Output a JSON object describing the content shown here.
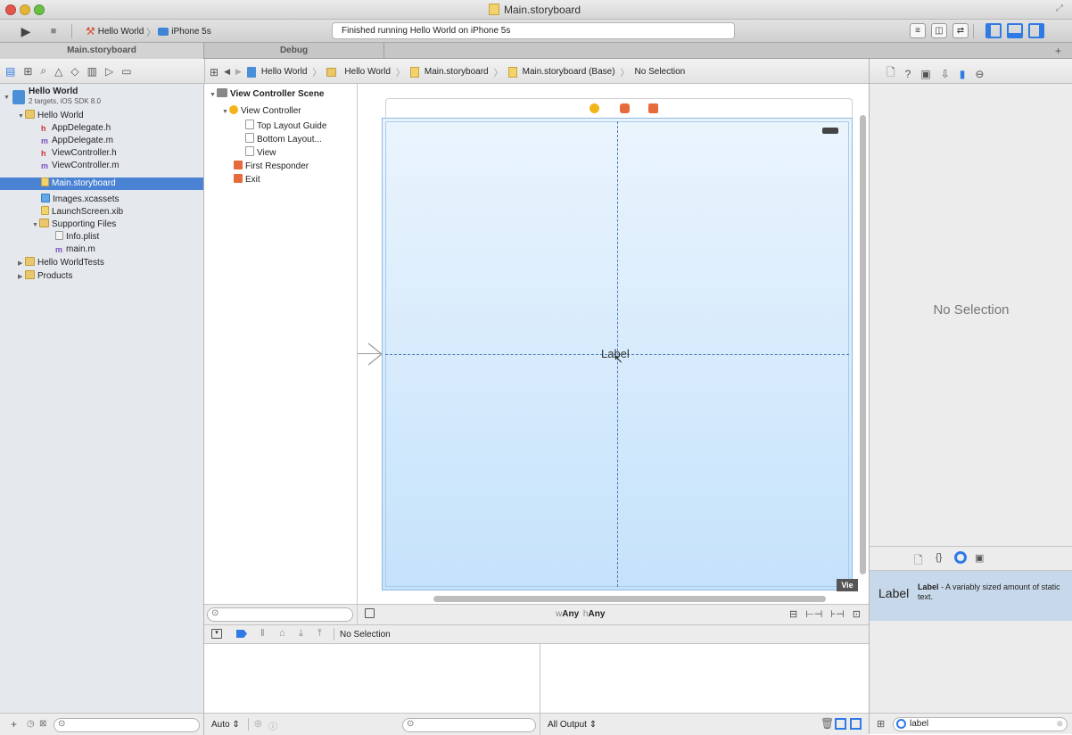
{
  "window": {
    "title": "Main.storyboard"
  },
  "toolbar": {
    "run_label": "▶",
    "stop_label": "■",
    "scheme": {
      "project": "Hello World",
      "separator": "〉",
      "device": "iPhone 5s"
    },
    "status_text": "Finished running Hello World on iPhone 5s"
  },
  "tabs": [
    {
      "label": "Main.storyboard"
    },
    {
      "label": "Debug"
    }
  ],
  "jumpbar": {
    "items": [
      "Hello World",
      "Hello World",
      "Main.storyboard",
      "Main.storyboard (Base)",
      "No Selection"
    ]
  },
  "navigator": {
    "project": {
      "name": "Hello World",
      "subtitle": "2 targets, iOS SDK 8.0"
    },
    "items": [
      {
        "label": "Hello World",
        "type": "folder"
      },
      {
        "label": "AppDelegate.h",
        "type": "h"
      },
      {
        "label": "AppDelegate.m",
        "type": "m"
      },
      {
        "label": "ViewController.h",
        "type": "h"
      },
      {
        "label": "ViewController.m",
        "type": "m"
      },
      {
        "label": "Main.storyboard",
        "type": "storyboard",
        "selected": true
      },
      {
        "label": "Images.xcassets",
        "type": "assets"
      },
      {
        "label": "LaunchScreen.xib",
        "type": "xib"
      },
      {
        "label": "Supporting Files",
        "type": "folder"
      },
      {
        "label": "Info.plist",
        "type": "plist"
      },
      {
        "label": "main.m",
        "type": "m"
      },
      {
        "label": "Hello WorldTests",
        "type": "folder"
      },
      {
        "label": "Products",
        "type": "folder"
      }
    ]
  },
  "outline": {
    "scene": "View Controller Scene",
    "view_controller": "View Controller",
    "top_guide": "Top Layout Guide",
    "bottom_guide": "Bottom Layout...",
    "view": "View",
    "first_responder": "First Responder",
    "exit": "Exit"
  },
  "canvas": {
    "label_text": "Label",
    "size_class": {
      "w_prefix": "w",
      "w_value": "Any",
      "h_prefix": "h",
      "h_value": "Any"
    },
    "corner_badge": "Vie"
  },
  "debug": {
    "status": "No Selection",
    "auto_label": "Auto",
    "output_label": "All Output"
  },
  "inspector": {
    "no_selection": "No Selection",
    "library_item": {
      "icon_text": "Label",
      "title": "Label",
      "description": " - A variably sized amount of static text."
    },
    "filter_value": "label"
  },
  "colors": {
    "selection": "#4a82d4",
    "accent_blue": "#3d7be0",
    "canvas_top": "#eaf4fd",
    "canvas_bottom": "#c5e2fb"
  }
}
